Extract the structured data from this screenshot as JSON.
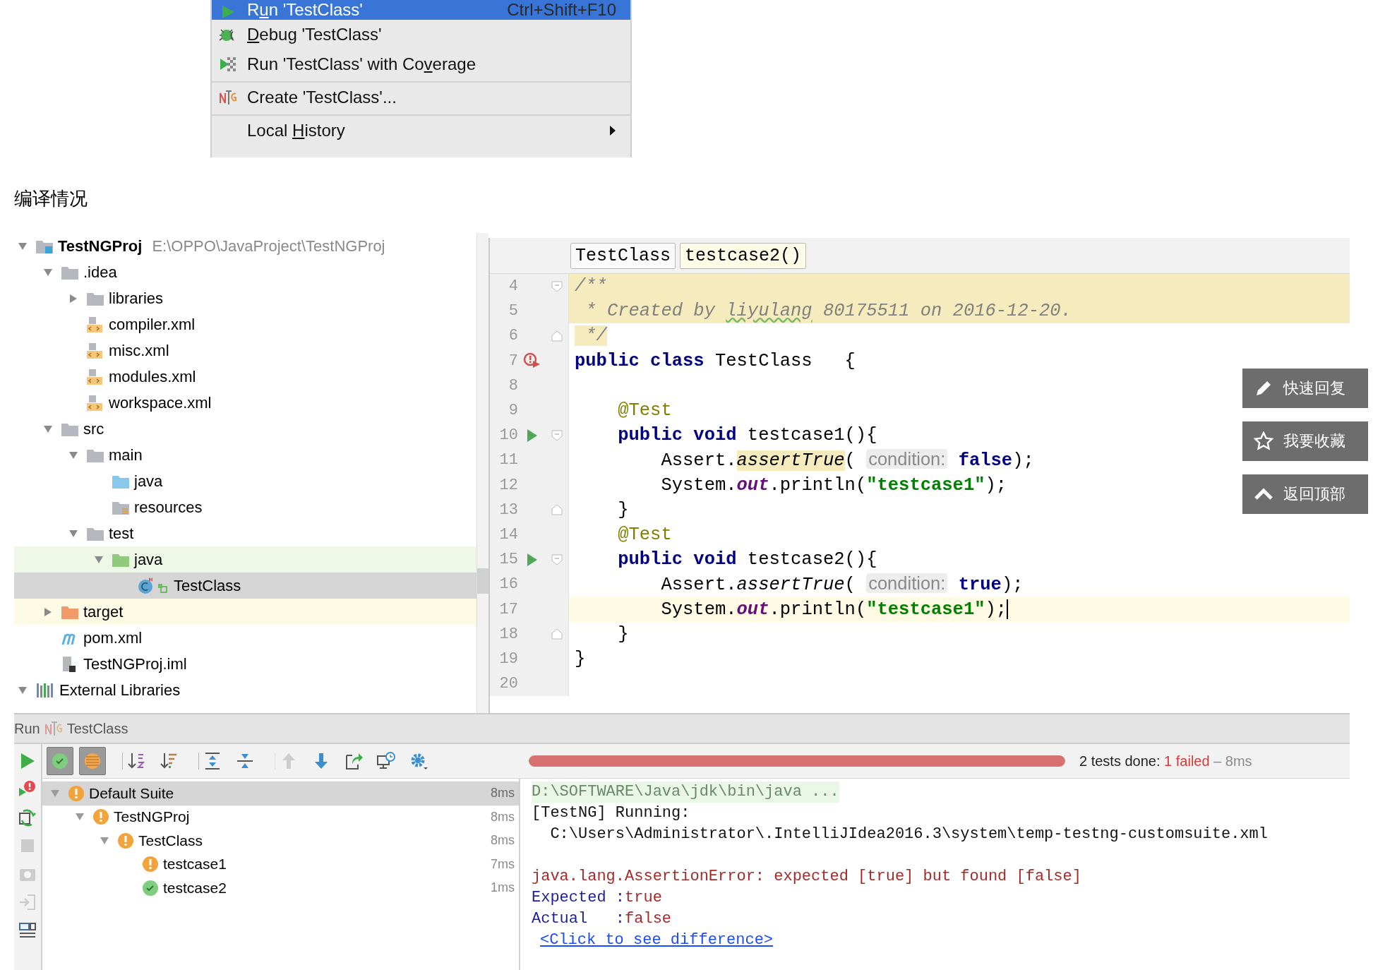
{
  "context_menu": {
    "items": [
      {
        "kind": "run",
        "label": [
          {
            "text": "R",
            "mnemonic": false
          },
          {
            "text": "u",
            "mnemonic": true
          },
          {
            "text": "n 'TestClass'",
            "mnemonic": false
          }
        ],
        "shortcut": "Ctrl+Shift+F10",
        "selected": true,
        "separator_before": false,
        "submenu": false
      },
      {
        "kind": "debug",
        "label": [
          {
            "text": "D",
            "mnemonic": true
          },
          {
            "text": "ebug 'TestClass'",
            "mnemonic": false
          }
        ],
        "selected": false,
        "separator_before": false,
        "submenu": false
      },
      {
        "kind": "coverage",
        "label": [
          {
            "text": "Run 'TestClass' with Co",
            "mnemonic": false
          },
          {
            "text": "v",
            "mnemonic": true
          },
          {
            "text": "erage",
            "mnemonic": false
          }
        ],
        "selected": false,
        "separator_before": false,
        "submenu": false
      },
      {
        "kind": "testng",
        "label": [
          {
            "text": "Create 'TestClass'...",
            "mnemonic": false
          }
        ],
        "selected": false,
        "separator_before": true,
        "submenu": false
      },
      {
        "kind": "none",
        "label": [
          {
            "text": "Local ",
            "mnemonic": false
          },
          {
            "text": "H",
            "mnemonic": true
          },
          {
            "text": "istory",
            "mnemonic": false
          }
        ],
        "selected": false,
        "separator_before": true,
        "submenu": true
      }
    ]
  },
  "heading": "编译情况",
  "project_tree": [
    {
      "kind": "project",
      "label": "TestNGProj",
      "path": "E:\\OPPO\\JavaProject\\TestNGProj",
      "expanded": true,
      "selected": false,
      "children": [
        {
          "kind": "folder",
          "label": ".idea",
          "expanded": true,
          "selected": false,
          "children": [
            {
              "kind": "folder",
              "label": "libraries",
              "expanded": false,
              "selected": false
            },
            {
              "kind": "xml",
              "label": "compiler.xml",
              "selected": false
            },
            {
              "kind": "xml",
              "label": "misc.xml",
              "selected": false
            },
            {
              "kind": "xml",
              "label": "modules.xml",
              "selected": false
            },
            {
              "kind": "xml",
              "label": "workspace.xml",
              "selected": false
            }
          ]
        },
        {
          "kind": "folder",
          "label": "src",
          "expanded": true,
          "selected": false,
          "children": [
            {
              "kind": "folder",
              "label": "main",
              "expanded": true,
              "selected": false,
              "children": [
                {
                  "kind": "source-folder",
                  "label": "java",
                  "selected": false
                },
                {
                  "kind": "resources-folder",
                  "label": "resources",
                  "selected": false
                }
              ]
            },
            {
              "kind": "folder",
              "label": "test",
              "expanded": true,
              "selected": false,
              "children": [
                {
                  "kind": "test-folder",
                  "label": "java",
                  "expanded": true,
                  "selected": false,
                  "test_scope": true,
                  "children": [
                    {
                      "kind": "class",
                      "label": "TestClass",
                      "selected": true
                    }
                  ]
                }
              ]
            }
          ]
        },
        {
          "kind": "excluded-folder",
          "label": "target",
          "expanded": false,
          "selected": false,
          "excluded": true
        },
        {
          "kind": "maven",
          "label": "pom.xml",
          "selected": false
        },
        {
          "kind": "iml",
          "label": "TestNGProj.iml",
          "selected": false
        }
      ]
    },
    {
      "kind": "libraries",
      "label": "External Libraries",
      "expanded": true,
      "selected": false
    }
  ],
  "editor": {
    "breadcrumbs": [
      {
        "label": "TestClass",
        "selected": false
      },
      {
        "label": "testcase2()",
        "selected": true
      }
    ],
    "lines": [
      {
        "number": "4",
        "fold_start": true,
        "doc_block": true,
        "tokens": [
          {
            "kind": "comment",
            "text": "/**"
          }
        ]
      },
      {
        "number": "5",
        "doc_block": true,
        "tokens": [
          {
            "kind": "comment",
            "text": " * Created by "
          },
          {
            "kind": "typo",
            "text": "liyulang"
          },
          {
            "kind": "comment",
            "text": " 80175511 on 2016-12-20."
          }
        ]
      },
      {
        "number": "6",
        "fold_end": true,
        "doc_tail": true,
        "tokens": [
          {
            "kind": "comment",
            "text": " */"
          }
        ]
      },
      {
        "number": "7",
        "failed_gutter": true,
        "tokens": [
          {
            "kind": "keyword",
            "text": "public class "
          },
          {
            "kind": "plain",
            "text": "TestClass   {"
          }
        ]
      },
      {
        "number": "8"
      },
      {
        "number": "9",
        "tokens": [
          {
            "kind": "annotation",
            "text": "    @Test"
          }
        ]
      },
      {
        "number": "10",
        "run_gutter": true,
        "fold_start": true,
        "tokens": [
          {
            "kind": "keyword",
            "text": "    public void "
          },
          {
            "kind": "plain",
            "text": "testcase1(){"
          }
        ]
      },
      {
        "number": "11",
        "tokens": [
          {
            "kind": "plain",
            "text": "        Assert."
          },
          {
            "kind": "warning",
            "text": "assertTrue"
          },
          {
            "kind": "plain",
            "text": "( "
          },
          {
            "kind": "hint",
            "text": "condition:"
          },
          {
            "kind": "keyword",
            "text": " false"
          },
          {
            "kind": "plain",
            "text": ");"
          }
        ]
      },
      {
        "number": "12",
        "tokens": [
          {
            "kind": "plain",
            "text": "        System."
          },
          {
            "kind": "field",
            "text": "out"
          },
          {
            "kind": "plain",
            "text": ".println("
          },
          {
            "kind": "string",
            "text": "\"testcase1\""
          },
          {
            "kind": "plain",
            "text": ");"
          }
        ]
      },
      {
        "number": "13",
        "fold_end": true,
        "tokens": [
          {
            "kind": "plain",
            "text": "    }"
          }
        ]
      },
      {
        "number": "14",
        "tokens": [
          {
            "kind": "annotation",
            "text": "    @Test"
          }
        ]
      },
      {
        "number": "15",
        "run_gutter": true,
        "fold_start": true,
        "tokens": [
          {
            "kind": "keyword",
            "text": "    public void "
          },
          {
            "kind": "plain",
            "text": "testcase2(){"
          }
        ]
      },
      {
        "number": "16",
        "tokens": [
          {
            "kind": "plain",
            "text": "        Assert."
          },
          {
            "kind": "method",
            "text": "assertTrue"
          },
          {
            "kind": "plain",
            "text": "( "
          },
          {
            "kind": "hint",
            "text": "condition:"
          },
          {
            "kind": "keyword",
            "text": " true"
          },
          {
            "kind": "plain",
            "text": ");"
          }
        ]
      },
      {
        "number": "17",
        "caret": true,
        "tokens": [
          {
            "kind": "plain",
            "text": "        System."
          },
          {
            "kind": "field",
            "text": "out"
          },
          {
            "kind": "plain",
            "text": ".println("
          },
          {
            "kind": "string",
            "text": "\"testcase1\""
          },
          {
            "kind": "plain",
            "text": ");"
          }
        ]
      },
      {
        "number": "18",
        "fold_end": true,
        "tokens": [
          {
            "kind": "plain",
            "text": "    }"
          }
        ]
      },
      {
        "number": "19",
        "tokens": [
          {
            "kind": "plain",
            "text": "}"
          }
        ]
      },
      {
        "number": "20"
      }
    ]
  },
  "float_buttons": [
    {
      "kind": "reply",
      "label": "快速回复"
    },
    {
      "kind": "favorite",
      "label": "我要收藏"
    },
    {
      "kind": "top",
      "label": "返回顶部"
    }
  ],
  "run_panel": {
    "title": "Run",
    "config": "TestClass",
    "side_tools": [
      {
        "kind": "run",
        "disabled": false
      },
      {
        "kind": "rerun-failed",
        "disabled": false
      },
      {
        "kind": "auto-test",
        "disabled": false
      },
      {
        "kind": "stop",
        "disabled": true
      },
      {
        "kind": "camera",
        "disabled": true
      },
      {
        "kind": "exit",
        "disabled": true
      },
      {
        "kind": "layout",
        "disabled": false
      }
    ],
    "tools": [
      {
        "kind": "show-passed",
        "pressed": true,
        "disabled": false,
        "group_start": false
      },
      {
        "kind": "show-ignored",
        "pressed": true,
        "disabled": false,
        "group_start": false
      },
      {
        "kind": "sort-alpha",
        "pressed": false,
        "disabled": false,
        "group_start": true
      },
      {
        "kind": "sort-duration",
        "pressed": false,
        "disabled": false,
        "group_start": false
      },
      {
        "kind": "expand-all",
        "pressed": false,
        "disabled": false,
        "group_start": true
      },
      {
        "kind": "collapse-all",
        "pressed": false,
        "disabled": false,
        "group_start": false
      },
      {
        "kind": "previous",
        "pressed": false,
        "disabled": true,
        "group_start": true
      },
      {
        "kind": "next",
        "pressed": false,
        "disabled": false,
        "group_start": false
      },
      {
        "kind": "export",
        "pressed": false,
        "disabled": false,
        "group_start": false
      },
      {
        "kind": "history",
        "pressed": false,
        "disabled": false,
        "group_start": false
      },
      {
        "kind": "settings",
        "pressed": false,
        "disabled": false,
        "group_start": false
      }
    ],
    "progress": {
      "level": 1,
      "kind": "failed",
      "done": "2 tests done:",
      "failed": "1 failed",
      "time": "– 8ms"
    },
    "results": [
      {
        "label": "Default Suite",
        "kind": "failed",
        "time": "8ms",
        "expanded": true,
        "selected": true,
        "children": [
          {
            "label": "TestNGProj",
            "kind": "failed",
            "time": "8ms",
            "expanded": true,
            "selected": false,
            "children": [
              {
                "label": "TestClass",
                "kind": "failed",
                "time": "8ms",
                "expanded": true,
                "selected": false,
                "children": [
                  {
                    "label": "testcase1",
                    "kind": "failed",
                    "time": "7ms",
                    "selected": false
                  },
                  {
                    "label": "testcase2",
                    "kind": "passed",
                    "time": "1ms",
                    "selected": false
                  }
                ]
              }
            ]
          }
        ]
      }
    ],
    "console": [
      {
        "kind": "command",
        "text": "D:\\SOFTWARE\\Java\\jdk\\bin\\java ..."
      },
      {
        "kind": "plain",
        "text": "[TestNG] Running:"
      },
      {
        "kind": "plain",
        "text": "  C:\\Users\\Administrator\\.IntelliJIdea2016.3\\system\\temp-testng-customsuite.xml"
      },
      {
        "kind": "error",
        "text": "java.lang.AssertionError: expected [true] but found [false]",
        "gap_before": true
      },
      {
        "kind": "compare",
        "label": "Expected :",
        "value": "true"
      },
      {
        "kind": "compare",
        "label": "Actual   :",
        "value": "false"
      },
      {
        "kind": "link",
        "text": "<Click to see difference>"
      }
    ]
  }
}
